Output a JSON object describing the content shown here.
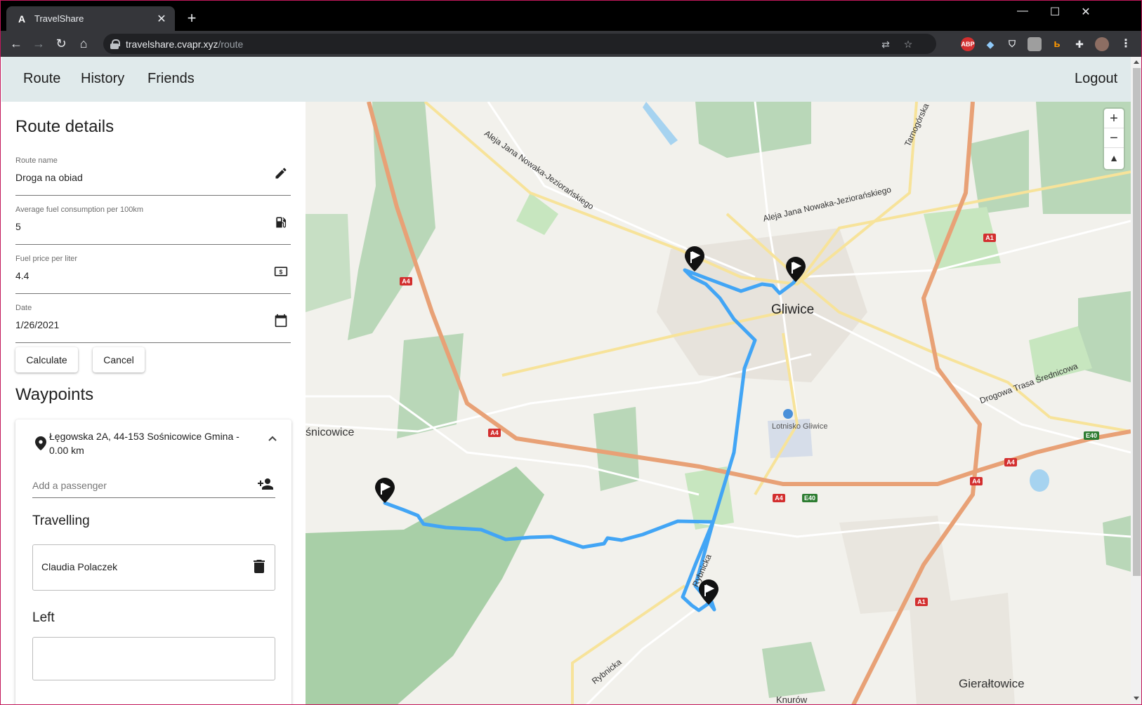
{
  "browser": {
    "tab_title": "TravelShare",
    "url_host": "travelshare.cvapr.xyz",
    "url_path": "/route",
    "extensions": [
      "ABP"
    ]
  },
  "nav": {
    "route": "Route",
    "history": "History",
    "friends": "Friends",
    "logout": "Logout"
  },
  "route_details": {
    "title": "Route details",
    "name_label": "Route name",
    "name_value": "Droga na obiad",
    "fuel_label": "Average fuel consumption per 100km",
    "fuel_value": "5",
    "price_label": "Fuel price per liter",
    "price_value": "4.4",
    "date_label": "Date",
    "date_value": "1/26/2021",
    "calculate": "Calculate",
    "cancel": "Cancel"
  },
  "waypoints": {
    "title": "Waypoints",
    "address": "Łęgowska 2A, 44-153 Sośnicowice Gmina - 0.00 km",
    "passenger_placeholder": "Add a passenger",
    "travelling_title": "Travelling",
    "travelling_passengers": [
      "Claudia Polaczek"
    ],
    "left_title": "Left"
  },
  "map": {
    "labels": {
      "gliwice": "Gliwice",
      "lotnisko": "Lotnisko Gliwice",
      "gieraltowice": "Gierałtowice",
      "sosnicowice": "śnicowice",
      "knurow": "Knurów",
      "aleja1": "Aleja Jana Nowaka-Jeziorańskiego",
      "aleja2": "Aleja Jana Nowaka-Jeziorańskiego",
      "tarnogorska": "Tarnogórska",
      "drogowa": "Drogowa Trasa Średnicowa",
      "rybnicka1": "Rybnicka",
      "rybnicka2": "Rybnicka",
      "a4": "A4",
      "a1": "A1",
      "e40": "E40"
    },
    "route_color": "#42a5f5"
  }
}
